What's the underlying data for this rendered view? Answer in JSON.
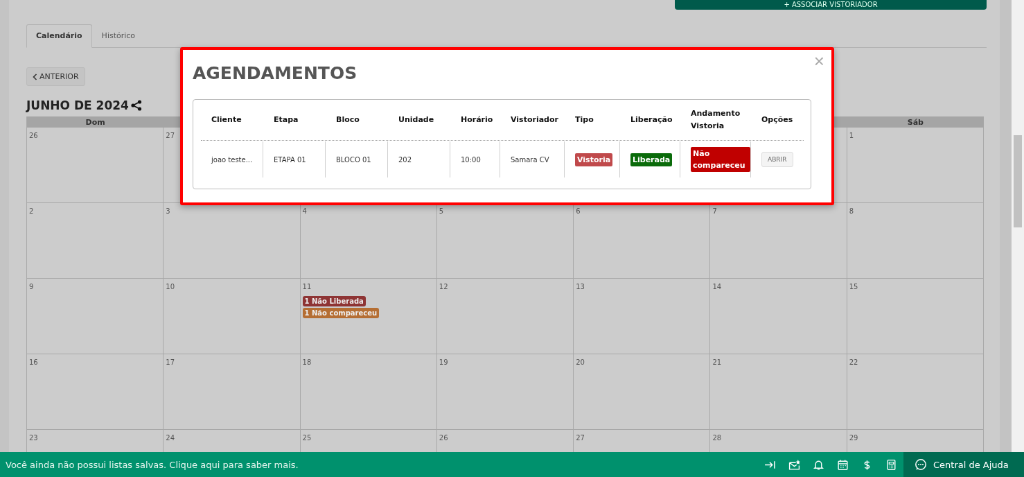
{
  "top_button": {
    "label": "+ ASSOCIAR VISTORIADOR"
  },
  "tabs": [
    {
      "label": "Calendário",
      "selected": true
    },
    {
      "label": "Histórico",
      "selected": false
    }
  ],
  "prev_button": {
    "label": "ANTERIOR"
  },
  "month_title": "JUNHO DE 2024",
  "calendar": {
    "weekday_first": "Dom",
    "weekday_last": "Sáb",
    "first_week": {
      "start": [
        {
          "day": "26"
        },
        {
          "day": "27"
        }
      ],
      "end": [
        {
          "day": "1"
        }
      ]
    },
    "weeks": [
      [
        {
          "day": "2"
        },
        {
          "day": "3"
        },
        {
          "day": "4"
        },
        {
          "day": "5"
        },
        {
          "day": "6"
        },
        {
          "day": "7"
        },
        {
          "day": "8"
        }
      ],
      [
        {
          "day": "9"
        },
        {
          "day": "10"
        },
        {
          "day": "11",
          "events": [
            {
              "label": "1 Não Liberada",
              "color": "#8e3434"
            },
            {
              "label": "1 Não compareceu",
              "color": "#b56e33"
            }
          ]
        },
        {
          "day": "12"
        },
        {
          "day": "13"
        },
        {
          "day": "14"
        },
        {
          "day": "15"
        }
      ],
      [
        {
          "day": "16"
        },
        {
          "day": "17"
        },
        {
          "day": "18"
        },
        {
          "day": "19"
        },
        {
          "day": "20"
        },
        {
          "day": "21"
        },
        {
          "day": "22"
        }
      ],
      [
        {
          "day": "23"
        },
        {
          "day": "24"
        },
        {
          "day": "25"
        },
        {
          "day": "26"
        },
        {
          "day": "27"
        },
        {
          "day": "28"
        },
        {
          "day": "29"
        }
      ]
    ]
  },
  "modal": {
    "title": "AGENDAMENTOS",
    "close": "×",
    "columns": [
      "Cliente",
      "Etapa",
      "Bloco",
      "Unidade",
      "Horário",
      "Vistoriador",
      "Tipo",
      "Liberação",
      "Andamento Vistoria",
      "Opções"
    ],
    "rows": [
      [
        {
          "kind": "text",
          "text": "joao teste..."
        },
        {
          "kind": "text",
          "text": "ETAPA 01"
        },
        {
          "kind": "text",
          "text": "BLOCO 01"
        },
        {
          "kind": "text",
          "text": "202"
        },
        {
          "kind": "text",
          "text": "10:00"
        },
        {
          "kind": "text",
          "text": "Samara CV"
        },
        {
          "kind": "badge",
          "text": "Vistoria",
          "color": "#c0494b"
        },
        {
          "kind": "badge",
          "text": "Liberada",
          "color": "#0a6b0a"
        },
        {
          "kind": "badge",
          "text": "Não compareceu",
          "color": "#c00000"
        },
        {
          "kind": "button",
          "text": "ABRIR"
        }
      ]
    ]
  },
  "footer": {
    "message": "Você ainda não possui listas salvas. Clique aqui para saber mais.",
    "help": "Central de Ajuda"
  }
}
